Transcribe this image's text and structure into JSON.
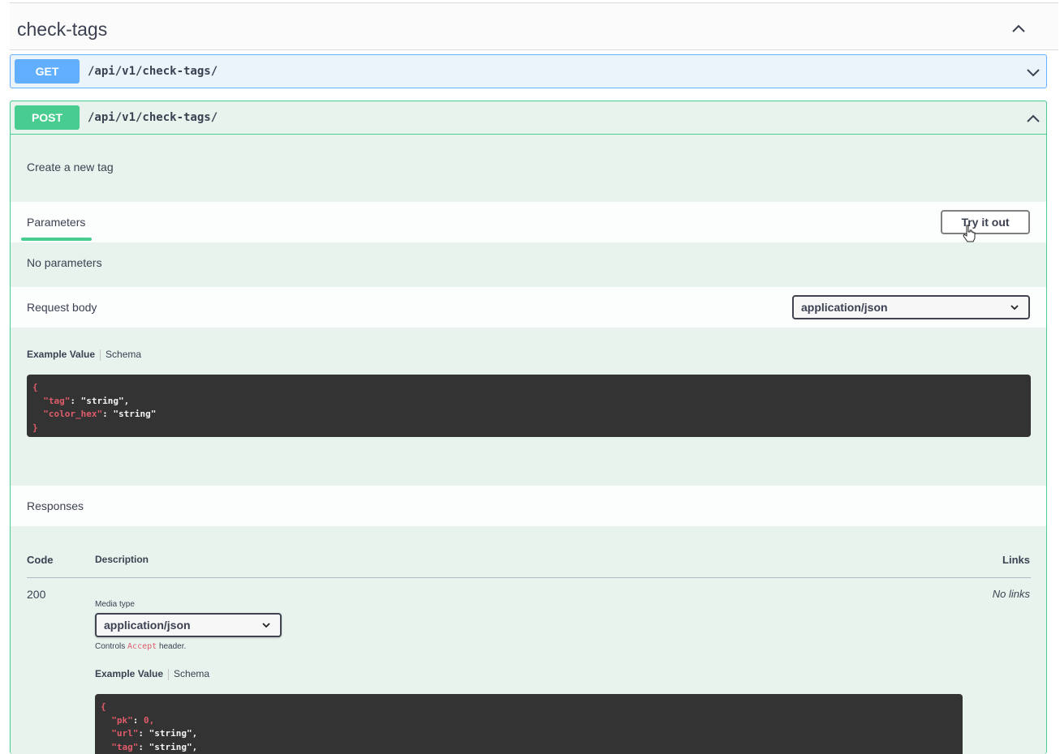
{
  "tag": {
    "title": "check-tags"
  },
  "get_op": {
    "method": "GET",
    "path": "/api/v1/check-tags/"
  },
  "post_op": {
    "method": "POST",
    "path": "/api/v1/check-tags/",
    "description": "Create a new tag",
    "parameters_label": "Parameters",
    "try_it_out_label": "Try it out",
    "no_parameters": "No parameters",
    "request_body_label": "Request body",
    "request_content_type": "application/json",
    "example_tab": "Example Value",
    "schema_tab": "Schema",
    "request_example": {
      "open": "{",
      "line1_key": "\"tag\"",
      "line1_val": "\"string\",",
      "line2_key": "\"color_hex\"",
      "line2_val": "\"string\"",
      "close": "}"
    },
    "responses_label": "Responses",
    "table_headers": {
      "code": "Code",
      "description": "Description",
      "links": "Links"
    },
    "response": {
      "code": "200",
      "links": "No links",
      "media_type_label": "Media type",
      "media_type": "application/json",
      "controls_prefix": "Controls",
      "controls_code": "Accept",
      "controls_suffix": "header.",
      "example_tab": "Example Value",
      "schema_tab": "Schema",
      "example": {
        "open": "{",
        "line1_key": "\"pk\"",
        "line1_val": "0,",
        "line2_key": "\"url\"",
        "line2_val": "\"string\",",
        "line3_key": "\"tag\"",
        "line3_val": "\"string\","
      }
    }
  },
  "colors": {
    "get": "#61affe",
    "post": "#49cc90",
    "code_bg": "#333333"
  },
  "icons": [
    "chevron-up-icon",
    "chevron-down-icon",
    "pointer-cursor-icon",
    "caret-down-icon"
  ]
}
